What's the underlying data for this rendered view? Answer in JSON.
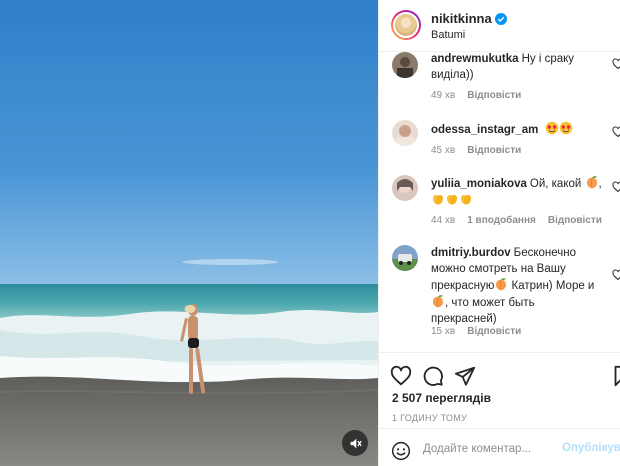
{
  "post": {
    "username": "nikitkinna",
    "location": "Batumi"
  },
  "comments": [
    {
      "username": "andrewmukutka",
      "text": "Ну і сраку виділа))",
      "time": "49 хв",
      "reply": "Відповісти"
    },
    {
      "username": "odessa_instagr_am",
      "text": "",
      "emojis": [
        "heart-eyes",
        "heart-eyes"
      ],
      "time": "45 хв",
      "reply": "Відповісти"
    },
    {
      "username": "yuliia_moniakova",
      "text": "Ой, какой",
      "emojis": [
        "peach",
        "clap",
        "clap",
        "clap"
      ],
      "time": "44 хв",
      "likes": "1 вподобання",
      "reply": "Відповісти"
    },
    {
      "username": "dmitriy.burdov",
      "text_1": "Бесконечно можно смотреть на Вашу прекрасную",
      "text_2": "Катрин) Море и",
      "text_3": ", что может быть прекрасней)",
      "time": "15 хв",
      "reply": "Відповісти"
    }
  ],
  "stats": {
    "views": "2 507 переглядів",
    "posted": "1 ГОДИНУ ТОМУ"
  },
  "add_comment": {
    "placeholder": "Додайте коментар...",
    "publish": "Опублікувати"
  },
  "colors": {
    "link": "#0095f6",
    "publish_disabled": "#b2dffc",
    "secondary_text": "#8e8e8e"
  },
  "icons": {
    "verified": "verified-badge-icon",
    "like": "heart-icon",
    "comment": "speech-bubble-icon",
    "share": "paper-plane-icon",
    "save": "bookmark-icon",
    "emoji": "smiley-icon",
    "mute": "speaker-muted-icon"
  }
}
